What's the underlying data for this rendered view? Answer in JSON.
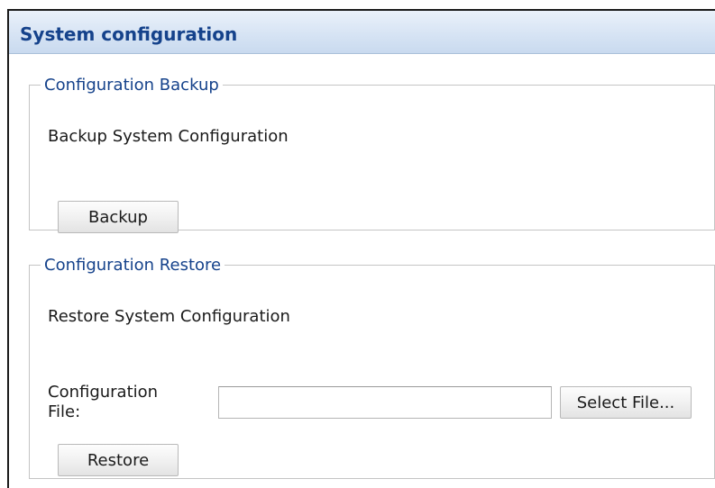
{
  "panel": {
    "title": "System configuration"
  },
  "backup": {
    "legend": "Configuration Backup",
    "description": "Backup System Configuration",
    "button_label": "Backup"
  },
  "restore": {
    "legend": "Configuration Restore",
    "description": "Restore System Configuration",
    "file_label_line1": "Configuration",
    "file_label_line2": "File:",
    "file_value": "",
    "select_button_label": "Select File...",
    "button_label": "Restore"
  },
  "colors": {
    "title_text": "#15428b",
    "header_bg": "#d7e4f4",
    "legend_text": "#15428b"
  }
}
